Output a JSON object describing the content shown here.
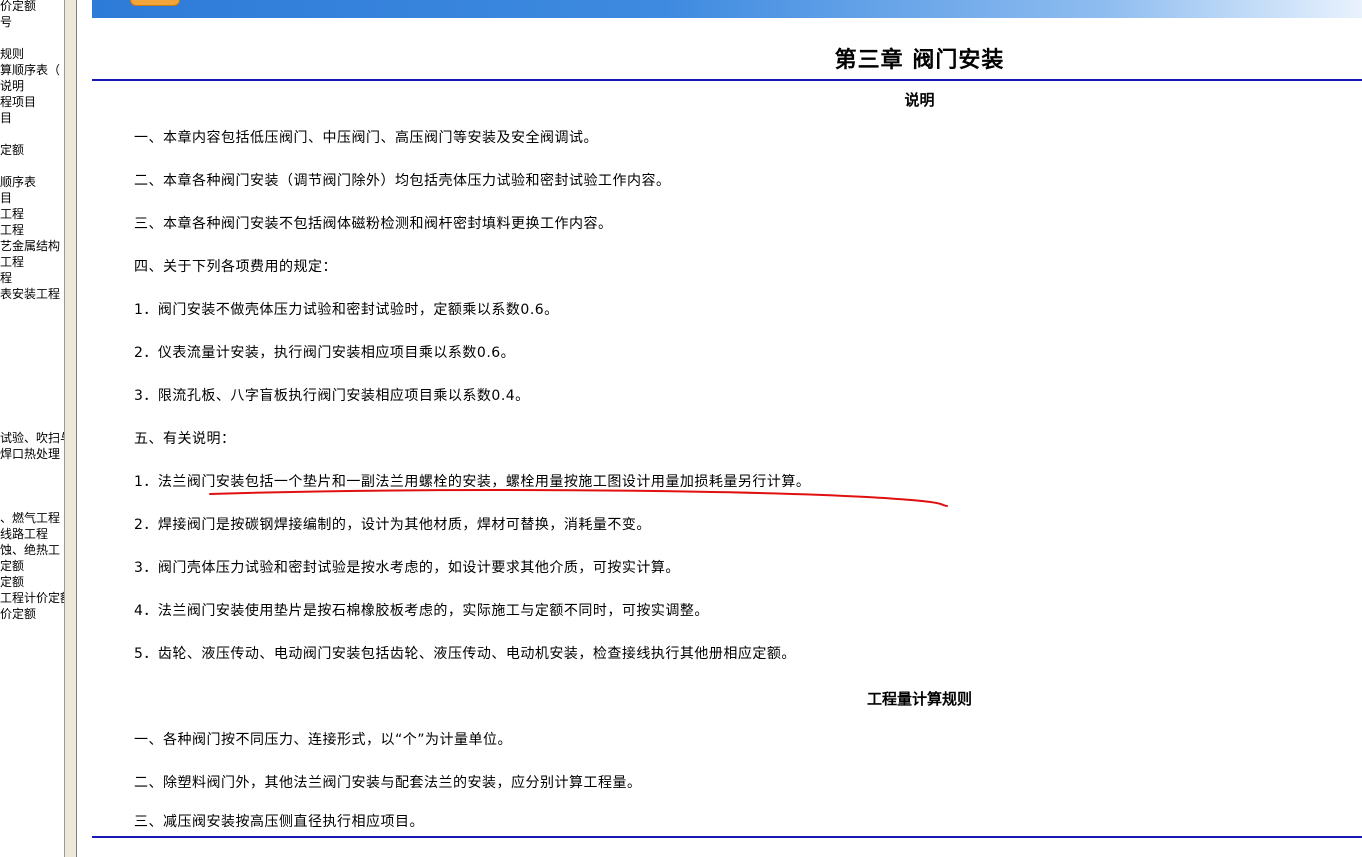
{
  "tree": {
    "items": [
      "价定额",
      "号",
      "",
      "规则",
      "算顺序表（",
      "说明",
      "程项目",
      "目",
      "",
      "定额",
      "",
      "顺序表",
      "目",
      "工程",
      "工程",
      "艺金属结构",
      "工程",
      "程",
      "表安装工程",
      "",
      "",
      "",
      "",
      "",
      "",
      "",
      "",
      "试验、吹扫与",
      "焊口热处理",
      "",
      "",
      "",
      "、燃气工程",
      "线路工程",
      "蚀、绝热工",
      "定额",
      "定额",
      "工程计价定额",
      "价定额"
    ]
  },
  "document": {
    "chapter_title": "第三章  阀门安装",
    "section_notes_title": "说明",
    "notes": [
      "一、本章内容包括低压阀门、中压阀门、高压阀门等安装及安全阀调试。",
      "二、本章各种阀门安装（调节阀门除外）均包括壳体压力试验和密封试验工作内容。",
      "三、本章各种阀门安装不包括阀体磁粉检测和阀杆密封填料更换工作内容。",
      "四、关于下列各项费用的规定：",
      "1．阀门安装不做壳体压力试验和密封试验时，定额乘以系数0.6。",
      "2．仪表流量计安装，执行阀门安装相应项目乘以系数0.6。",
      "3．限流孔板、八字盲板执行阀门安装相应项目乘以系数0.4。",
      "五、有关说明：",
      "1．法兰阀门安装包括一个垫片和一副法兰用螺栓的安装，螺栓用量按施工图设计用量加损耗量另行计算。",
      "2．焊接阀门是按碳钢焊接编制的，设计为其他材质，焊材可替换，消耗量不变。",
      "3．阀门壳体压力试验和密封试验是按水考虑的，如设计要求其他介质，可按实计算。",
      "4．法兰阀门安装使用垫片是按石棉橡胶板考虑的，实际施工与定额不同时，可按实调整。",
      "5．齿轮、液压传动、电动阀门安装包括齿轮、液压传动、电动机安装，检查接线执行其他册相应定额。"
    ],
    "section_rules_title": "工程量计算规则",
    "rules": [
      "一、各种阀门按不同压力、连接形式，以“个”为计量单位。",
      "二、除塑料阀门外，其他法兰阀门安装与配套法兰的安装，应分别计算工程量。",
      "三、减压阀安装按高压侧直径执行相应项目。"
    ]
  },
  "colors": {
    "banner_start": "#2d7bd8",
    "rule_line": "#1818b8",
    "annotation": "#e01010"
  }
}
